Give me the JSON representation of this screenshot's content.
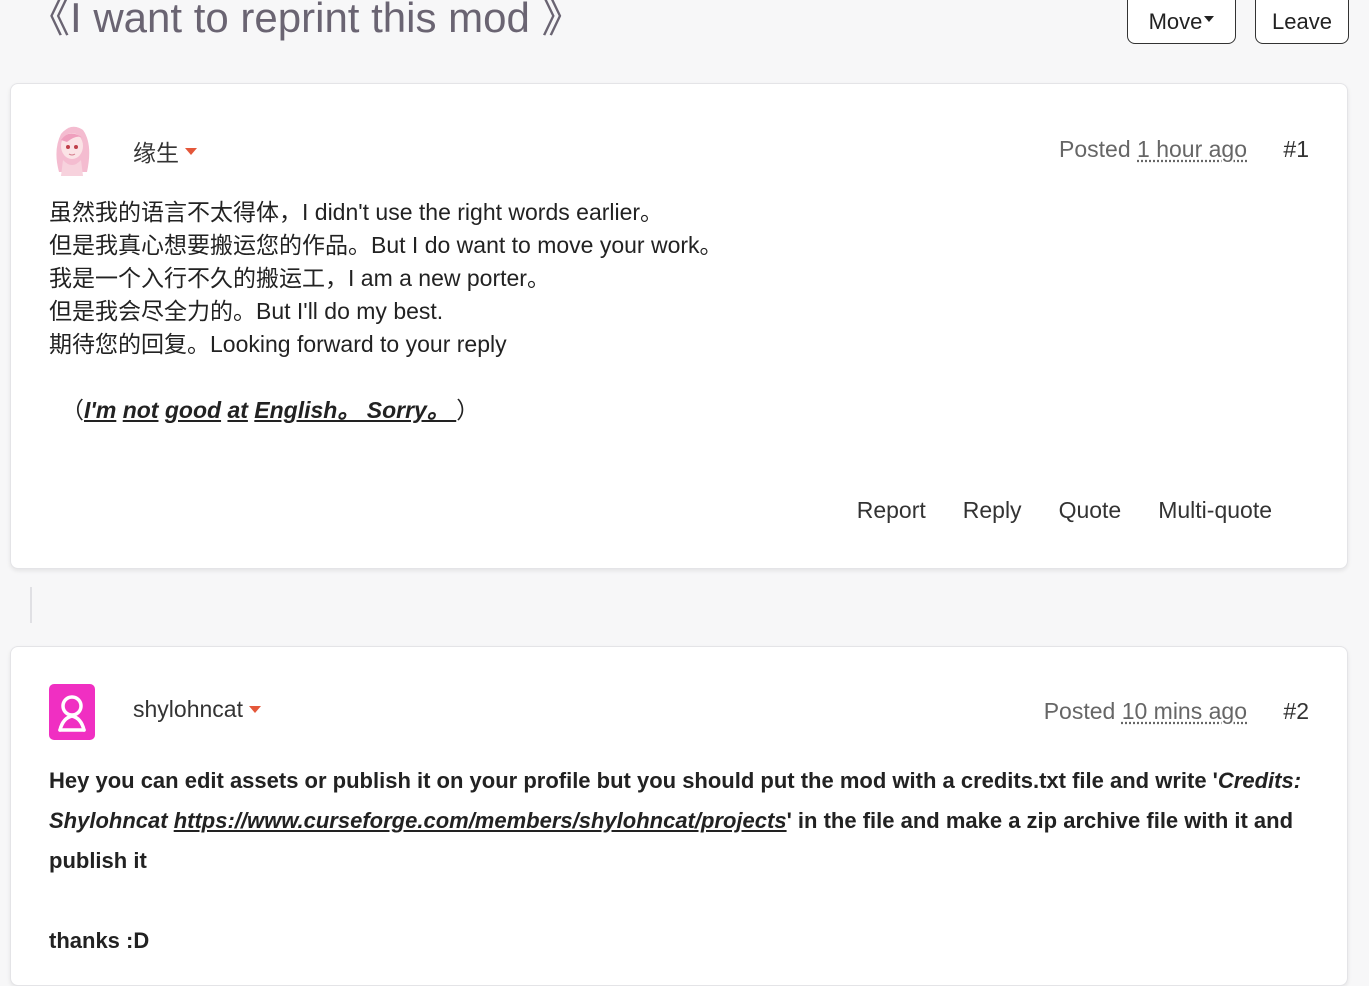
{
  "thread": {
    "title": "《I want to reprint this mod 》",
    "move_label": "Move",
    "leave_label": "Leave"
  },
  "posts": [
    {
      "username": "缘生",
      "posted_label": "Posted",
      "posted_ago": "1 hour ago",
      "number": "#1",
      "lines": [
        "虽然我的语言不太得体，I didn't use the right words earlier。",
        "但是我真心想要搬运您的作品。But I do want to move your work。",
        "我是一个入行不久的搬运工，I am a new porter。",
        "但是我会尽全力的。But I'll do my best.",
        "期待您的回复。Looking forward to your reply"
      ],
      "apology_open": "（",
      "apology_words": [
        "I'm",
        "not",
        "good",
        "at",
        "English。 Sorry。 "
      ],
      "apology_close": "）",
      "actions": [
        "Report",
        "Reply",
        "Quote",
        "Multi-quote"
      ]
    },
    {
      "username": "shylohncat",
      "posted_label": "Posted",
      "posted_ago": "10 mins ago",
      "number": "#2",
      "text_before": "Hey you can edit assets or publish it on your profile but you should put the mod with a credits.txt file and write '",
      "credits_text": "Credits: Shylohncat ",
      "credits_link": "https://www.curseforge.com/members/shylohncat/projects",
      "text_after": "' in the file and make a zip archive file with it and publish it",
      "thanks": "thanks :D"
    }
  ],
  "colors": {
    "accent_caret": "#e4573a",
    "avatar_magenta": "#f02fc2",
    "avatar_pink": "#f6c6d6"
  }
}
